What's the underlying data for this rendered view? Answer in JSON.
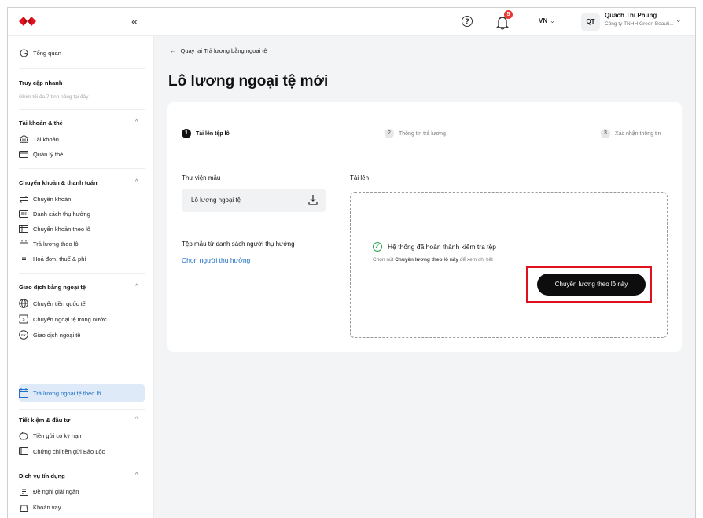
{
  "topbar": {
    "collapse_icon": "«",
    "help_icon": "?",
    "notification_count": "5",
    "language": "VN",
    "user_initials": "QT",
    "user_name": "Quach Thi Phung",
    "company": "Công ty TNHH Green Beauti..."
  },
  "sidebar": {
    "overview": "Tổng quan",
    "quick_access": "Truy cập nhanh",
    "quick_hint": "Ghim tối đa 7 tính năng tại đây",
    "sections": [
      {
        "title": "Tài khoản & thẻ",
        "items": [
          "Tài khoản",
          "Quản lý thẻ"
        ]
      },
      {
        "title": "Chuyển khoản & thanh toán",
        "items": [
          "Chuyển khoản",
          "Danh sách thụ hưởng",
          "Chuyển khoản theo lô",
          "Trả lương theo lô",
          "Hoá đơn, thuế & phí"
        ]
      },
      {
        "title": "Giao dịch bằng ngoại tệ",
        "items": [
          "Chuyển tiền quốc tế",
          "Chuyển ngoại tệ trong nước",
          "Giao dịch ngoại tệ",
          "Trả lương ngoại tệ theo lô"
        ]
      },
      {
        "title": "Tiết kiệm & đầu tư",
        "items": [
          "Tiền gửi có kỳ hạn",
          "Chứng chỉ tiền gửi Bảo Lộc"
        ]
      },
      {
        "title": "Dịch vụ tín dụng",
        "items": [
          "Đề nghị giải ngân",
          "Khoản vay"
        ]
      }
    ]
  },
  "main": {
    "back_label": "Quay lại Trả lương bằng ngoại tệ",
    "title": "Lô lương ngoại tệ mới",
    "steps": [
      {
        "num": "1",
        "label": "Tải lên tệp lô"
      },
      {
        "num": "2",
        "label": "Thông tin trả lương"
      },
      {
        "num": "3",
        "label": "Xác nhận thông tin"
      }
    ],
    "library_label": "Thư viện mẫu",
    "template_name": "Lô lương ngoại tệ",
    "beneficiary_template_label": "Tệp mẫu từ danh sách người thụ hưởng",
    "choose_beneficiary": "Chọn người thụ hưởng",
    "upload_label": "Tải lên",
    "check_success": "Hệ thống đã hoàn thành kiểm tra tệp",
    "hint_prefix": "Chọn nút ",
    "hint_bold": "Chuyển lương theo lô này",
    "hint_suffix": " để xem chi tiết",
    "primary_button": "Chuyển lương theo lô này"
  },
  "colors": {
    "brand_red": "#e0101e",
    "link_blue": "#1f6fc4",
    "active_bg": "#dfeaf8",
    "success_green": "#2ea44f"
  }
}
